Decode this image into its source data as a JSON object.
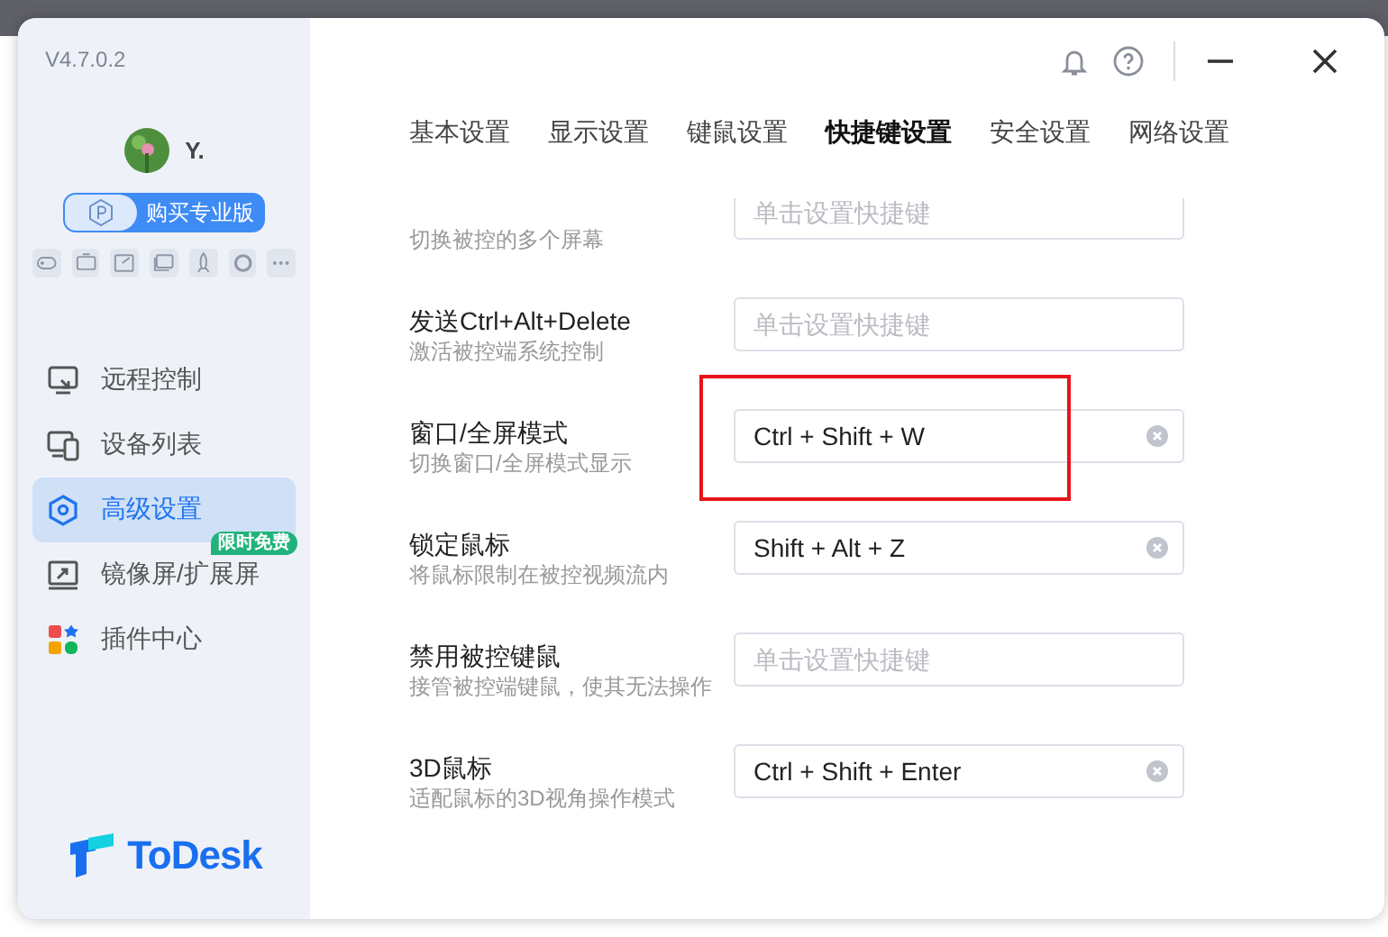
{
  "window": {
    "version": "V4.7.0.2"
  },
  "user": {
    "name": "Y."
  },
  "upgrade_button": {
    "label": "购买专业版"
  },
  "nav": [
    {
      "label": "远程控制",
      "selected": false
    },
    {
      "label": "设备列表",
      "selected": false
    },
    {
      "label": "高级设置",
      "selected": true
    },
    {
      "label": "镜像屏/扩展屏",
      "selected": false,
      "badge": "限时免费"
    },
    {
      "label": "插件中心",
      "selected": false
    }
  ],
  "brand": {
    "name": "ToDesk"
  },
  "tabs": [
    {
      "label": "基本设置",
      "selected": false
    },
    {
      "label": "显示设置",
      "selected": false
    },
    {
      "label": "键鼠设置",
      "selected": false
    },
    {
      "label": "快捷键设置",
      "selected": true
    },
    {
      "label": "安全设置",
      "selected": false
    },
    {
      "label": "网络设置",
      "selected": false
    }
  ],
  "shortcuts": [
    {
      "description": "切换被控的多个屏幕",
      "placeholder": "单击设置快捷键",
      "highlighted": false
    },
    {
      "title": "发送Ctrl+Alt+Delete",
      "description": "激活被控端系统控制",
      "placeholder": "单击设置快捷键",
      "highlighted": false
    },
    {
      "title": "窗口/全屏模式",
      "description": "切换窗口/全屏模式显示",
      "value": "Ctrl + Shift + W",
      "highlighted": true
    },
    {
      "title": "锁定鼠标",
      "description": "将鼠标限制在被控视频流内",
      "value": "Shift + Alt + Z",
      "highlighted": false
    },
    {
      "title": "禁用被控键鼠",
      "description": "接管被控端键鼠，使其无法操作",
      "placeholder": "单击设置快捷键",
      "highlighted": false
    },
    {
      "title": "3D鼠标",
      "description": "适配鼠标的3D视角操作模式",
      "value": "Ctrl + Shift + Enter",
      "highlighted": false
    }
  ]
}
